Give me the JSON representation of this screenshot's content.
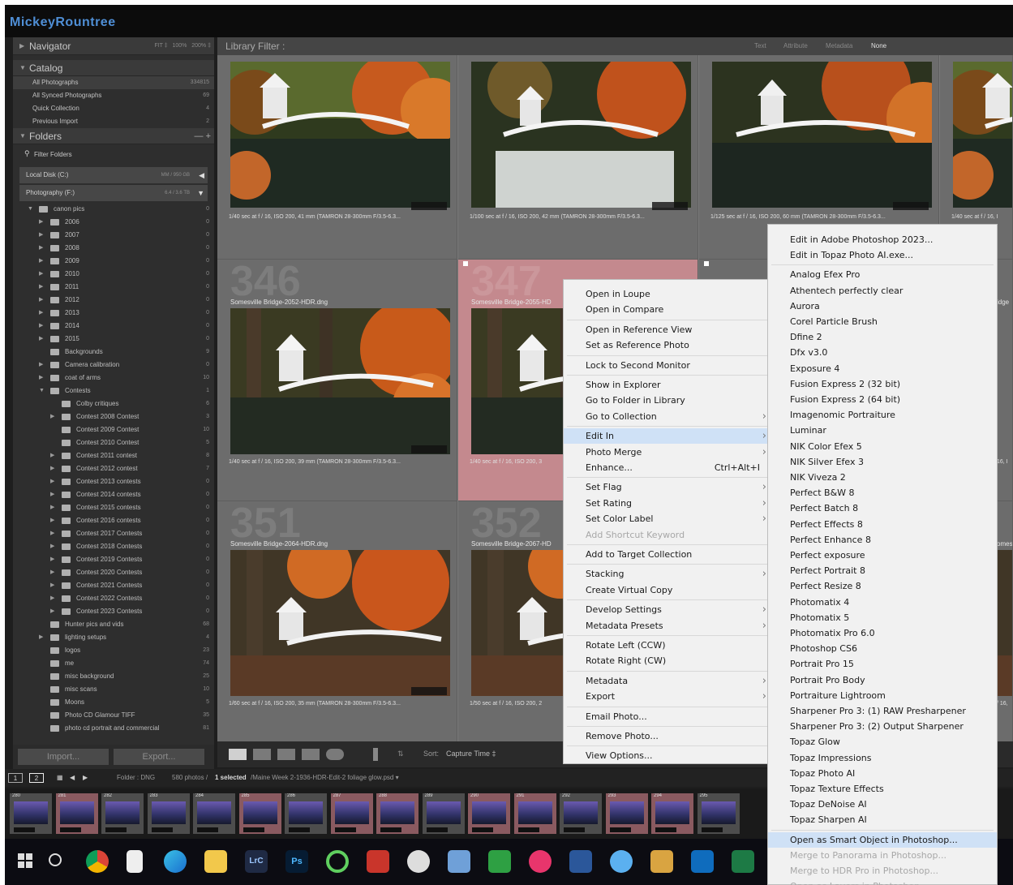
{
  "brand": {
    "name": "MickeyRountree"
  },
  "navigator": {
    "title": "Navigator",
    "zoom": [
      "FIT ‡",
      "100%",
      "200% ‡"
    ]
  },
  "catalog": {
    "title": "Catalog",
    "items": [
      {
        "label": "All Photographs",
        "count": "334815"
      },
      {
        "label": "All Synced Photographs",
        "count": "69"
      },
      {
        "label": "Quick Collection",
        "count": "4"
      },
      {
        "label": "Previous Import",
        "count": "2"
      }
    ]
  },
  "folders": {
    "title": "Folders",
    "actions": "— +",
    "filter": "Filter Folders",
    "volumes": [
      {
        "label": "Local Disk (C:)",
        "info": "MM / 950 GB"
      },
      {
        "label": "Photography (F:)",
        "info": "6.4 / 3.6 TB"
      }
    ],
    "items": [
      {
        "label": "canon pics",
        "count": "0",
        "level": 0,
        "exp": "open"
      },
      {
        "label": "2006",
        "count": "0",
        "level": 1,
        "exp": "closed"
      },
      {
        "label": "2007",
        "count": "0",
        "level": 1,
        "exp": "closed"
      },
      {
        "label": "2008",
        "count": "0",
        "level": 1,
        "exp": "closed"
      },
      {
        "label": "2009",
        "count": "0",
        "level": 1,
        "exp": "closed"
      },
      {
        "label": "2010",
        "count": "0",
        "level": 1,
        "exp": "closed"
      },
      {
        "label": "2011",
        "count": "0",
        "level": 1,
        "exp": "closed"
      },
      {
        "label": "2012",
        "count": "0",
        "level": 1,
        "exp": "closed"
      },
      {
        "label": "2013",
        "count": "0",
        "level": 1,
        "exp": "closed"
      },
      {
        "label": "2014",
        "count": "0",
        "level": 1,
        "exp": "closed"
      },
      {
        "label": "2015",
        "count": "0",
        "level": 1,
        "exp": "closed"
      },
      {
        "label": "Backgrounds",
        "count": "9",
        "level": 1,
        "exp": "none"
      },
      {
        "label": "Camera calibration",
        "count": "0",
        "level": 1,
        "exp": "closed"
      },
      {
        "label": "coat of arms",
        "count": "10",
        "level": 1,
        "exp": "closed"
      },
      {
        "label": "Contests",
        "count": "1",
        "level": 1,
        "exp": "open"
      },
      {
        "label": "Colby critiques",
        "count": "6",
        "level": 2,
        "exp": "none"
      },
      {
        "label": "Contest 2008 Contest",
        "count": "3",
        "level": 2,
        "exp": "closed"
      },
      {
        "label": "Contest 2009 Contest",
        "count": "10",
        "level": 2,
        "exp": "none"
      },
      {
        "label": "Contest 2010 Contest",
        "count": "5",
        "level": 2,
        "exp": "none"
      },
      {
        "label": "Contest 2011 contest",
        "count": "8",
        "level": 2,
        "exp": "closed"
      },
      {
        "label": "Contest 2012 contest",
        "count": "7",
        "level": 2,
        "exp": "closed"
      },
      {
        "label": "Contest 2013 contests",
        "count": "0",
        "level": 2,
        "exp": "closed"
      },
      {
        "label": "Contest 2014 contests",
        "count": "0",
        "level": 2,
        "exp": "closed"
      },
      {
        "label": "Contest 2015 contests",
        "count": "0",
        "level": 2,
        "exp": "closed"
      },
      {
        "label": "Contest 2016 contests",
        "count": "0",
        "level": 2,
        "exp": "closed"
      },
      {
        "label": "Contest 2017 Contests",
        "count": "0",
        "level": 2,
        "exp": "closed"
      },
      {
        "label": "Contest 2018 Contests",
        "count": "0",
        "level": 2,
        "exp": "closed"
      },
      {
        "label": "Contest 2019 Contests",
        "count": "0",
        "level": 2,
        "exp": "closed"
      },
      {
        "label": "Contest 2020 Contests",
        "count": "0",
        "level": 2,
        "exp": "closed"
      },
      {
        "label": "Contest 2021 Contests",
        "count": "0",
        "level": 2,
        "exp": "closed"
      },
      {
        "label": "Contest 2022 Contests",
        "count": "0",
        "level": 2,
        "exp": "closed"
      },
      {
        "label": "Contest 2023 Contests",
        "count": "0",
        "level": 2,
        "exp": "closed"
      },
      {
        "label": "Hunter pics and vids",
        "count": "68",
        "level": 1,
        "exp": "none"
      },
      {
        "label": "lighting setups",
        "count": "4",
        "level": 1,
        "exp": "closed"
      },
      {
        "label": "logos",
        "count": "23",
        "level": 1,
        "exp": "none"
      },
      {
        "label": "me",
        "count": "74",
        "level": 1,
        "exp": "none"
      },
      {
        "label": "misc background",
        "count": "25",
        "level": 1,
        "exp": "none"
      },
      {
        "label": "misc scans",
        "count": "10",
        "level": 1,
        "exp": "none"
      },
      {
        "label": "Moons",
        "count": "5",
        "level": 1,
        "exp": "none"
      },
      {
        "label": "Photo CD Glamour TIFF",
        "count": "35",
        "level": 1,
        "exp": "none"
      },
      {
        "label": "photo cd portrait and commercial",
        "count": "81",
        "level": 1,
        "exp": "none"
      }
    ]
  },
  "buttons": {
    "import": "Import...",
    "export": "Export..."
  },
  "library_filter": {
    "title": "Library Filter :",
    "tabs": [
      "Text",
      "Attribute",
      "Metadata",
      "None"
    ]
  },
  "grid": {
    "row1": [
      {
        "caption": "1/40 sec at f / 16, ISO 200, 41 mm (TAMRON 28-300mm F/3.5-6.3..."
      },
      {
        "caption": "1/100 sec at f / 16, ISO 200, 42 mm (TAMRON 28-300mm F/3.5-6.3..."
      },
      {
        "caption": "1/125 sec at f / 16, ISO 200, 60 mm (TAMRON 28-300mm F/3.5-6.3..."
      },
      {
        "caption": "1/40 sec at f / 16, I"
      }
    ],
    "row2": [
      {
        "num": "346",
        "file": "Somesville Bridge-2052-HDR.dng",
        "caption": "1/40 sec at f / 16, ISO 200, 39 mm (TAMRON 28-300mm F/3.5-6.3..."
      },
      {
        "num": "347",
        "file": "Somesville Bridge-2055-HD",
        "caption": "1/40 sec at f / 16, ISO 200, 3"
      }
    ],
    "row3": [
      {
        "num": "351",
        "file": "Somesville Bridge-2064-HDR.dng",
        "caption": "1/60 sec at f / 16, ISO 200, 35 mm (TAMRON 28-300mm F/3.5-6.3..."
      },
      {
        "num": "352",
        "file": "Somesville Bridge-2067-HD",
        "caption": "1/50 sec at f / 16, ISO 200, 2"
      }
    ],
    "right_edge": {
      "file": "idge",
      "caption": "16, I",
      "caption2": "/ 16,",
      "file3": "omes"
    }
  },
  "toolbar": {
    "sort_label": "Sort:",
    "sort_value": "Capture Time ‡"
  },
  "filmstrip": {
    "view1": "1",
    "view2": "2",
    "folder": "Folder : DNG",
    "count": "580 photos /",
    "selected": "1 selected",
    "path": "/Maine Week 2-1936-HDR-Edit-2 foliage glow.psd ▾",
    "numbers": [
      "280",
      "281",
      "282",
      "283",
      "284",
      "285",
      "286",
      "287",
      "288",
      "289",
      "290",
      "291",
      "292",
      "293",
      "294",
      "295"
    ]
  },
  "context_menu": {
    "items": [
      {
        "label": "Open in Loupe"
      },
      {
        "label": "Open in Compare"
      },
      {
        "sep": true
      },
      {
        "label": "Open in Reference View"
      },
      {
        "label": "Set as Reference Photo"
      },
      {
        "sep": true
      },
      {
        "label": "Lock to Second Monitor"
      },
      {
        "sep": true
      },
      {
        "label": "Show in Explorer"
      },
      {
        "label": "Go to Folder in Library"
      },
      {
        "label": "Go to Collection",
        "sub": true
      },
      {
        "sep": true
      },
      {
        "label": "Edit In",
        "sub": true,
        "hl": true
      },
      {
        "label": "Photo Merge",
        "sub": true
      },
      {
        "label": "Enhance...",
        "shortcut": "Ctrl+Alt+I"
      },
      {
        "sep": true
      },
      {
        "label": "Set Flag",
        "sub": true
      },
      {
        "label": "Set Rating",
        "sub": true
      },
      {
        "label": "Set Color Label",
        "sub": true
      },
      {
        "label": "Add Shortcut Keyword",
        "dis": true
      },
      {
        "sep": true
      },
      {
        "label": "Add to Target Collection"
      },
      {
        "sep": true
      },
      {
        "label": "Stacking",
        "sub": true
      },
      {
        "label": "Create Virtual Copy"
      },
      {
        "sep": true
      },
      {
        "label": "Develop Settings",
        "sub": true
      },
      {
        "label": "Metadata Presets",
        "sub": true
      },
      {
        "sep": true
      },
      {
        "label": "Rotate Left (CCW)"
      },
      {
        "label": "Rotate Right (CW)"
      },
      {
        "sep": true
      },
      {
        "label": "Metadata",
        "sub": true
      },
      {
        "label": "Export",
        "sub": true
      },
      {
        "sep": true
      },
      {
        "label": "Email Photo..."
      },
      {
        "sep": true
      },
      {
        "label": "Remove Photo..."
      },
      {
        "sep": true
      },
      {
        "label": "View Options..."
      }
    ]
  },
  "edit_in_menu": {
    "items": [
      {
        "label": "Edit in Adobe Photoshop 2023..."
      },
      {
        "label": "Edit in Topaz Photo AI.exe..."
      },
      {
        "sep": true
      },
      {
        "label": "Analog Efex Pro"
      },
      {
        "label": "Athentech perfectly clear"
      },
      {
        "label": "Aurora"
      },
      {
        "label": "Corel Particle Brush"
      },
      {
        "label": "Dfine 2"
      },
      {
        "label": "Dfx v3.0"
      },
      {
        "label": "Exposure 4"
      },
      {
        "label": "Fusion Express 2 (32 bit)"
      },
      {
        "label": "Fusion Express 2 (64 bit)"
      },
      {
        "label": "Imagenomic Portraiture"
      },
      {
        "label": "Luminar"
      },
      {
        "label": "NIK Color Efex 5"
      },
      {
        "label": "NIK Silver Efex 3"
      },
      {
        "label": "NIK Viveza 2"
      },
      {
        "label": "Perfect B&W 8"
      },
      {
        "label": "Perfect Batch 8"
      },
      {
        "label": "Perfect Effects 8"
      },
      {
        "label": "Perfect Enhance 8"
      },
      {
        "label": "Perfect exposure"
      },
      {
        "label": "Perfect Portrait 8"
      },
      {
        "label": "Perfect Resize 8"
      },
      {
        "label": "Photomatix 4"
      },
      {
        "label": "Photomatix 5"
      },
      {
        "label": "Photomatix Pro 6.0"
      },
      {
        "label": "Photoshop CS6"
      },
      {
        "label": "Portrait Pro 15"
      },
      {
        "label": "Portrait Pro Body"
      },
      {
        "label": "Portraiture Lightroom"
      },
      {
        "label": "Sharpener Pro 3: (1) RAW Presharpener"
      },
      {
        "label": "Sharpener Pro 3: (2) Output Sharpener"
      },
      {
        "label": "Topaz Glow"
      },
      {
        "label": "Topaz Impressions"
      },
      {
        "label": "Topaz Photo AI"
      },
      {
        "label": "Topaz Texture Effects"
      },
      {
        "label": "Topaz DeNoise AI"
      },
      {
        "label": "Topaz Sharpen AI"
      },
      {
        "sep": true
      },
      {
        "label": "Open as Smart Object in Photoshop...",
        "hl": true
      },
      {
        "label": "Merge to Panorama in Photoshop...",
        "dis": true
      },
      {
        "label": "Merge to HDR Pro in Photoshop...",
        "dis": true
      },
      {
        "label": "Open as Layers in Photoshop...",
        "dis": true
      }
    ]
  },
  "taskbar": {
    "apps": [
      "windows-start",
      "search",
      "chrome",
      "file",
      "edge",
      "file-explorer",
      "lightroom-classic",
      "photoshop",
      "sync",
      "app",
      "app",
      "app",
      "lock",
      "app",
      "word",
      "app",
      "library",
      "outlook",
      "excel"
    ],
    "lrc": "LrC",
    "ps": "Ps"
  }
}
